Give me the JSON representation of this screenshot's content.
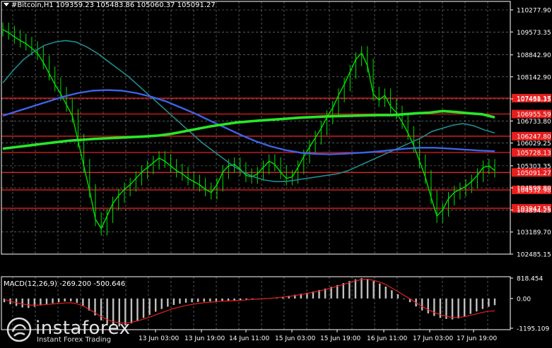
{
  "title": "#Bitcoin,H1  109359.23 105483.86 105060.37 105091.27",
  "macd_label": "MACD(12,26,9) -269.200 -500.646",
  "logo": {
    "brand": "instaforex",
    "tagline": "Instant Forex Trading"
  },
  "colors": {
    "background": "#000000",
    "candle": "#00e000",
    "ma_fast": "#208c8c",
    "ma_mid": "#3c64e6",
    "ma_slow": "#28e628",
    "level": "#e61e1e",
    "macd_hist": "#c0c0c0",
    "macd_signal": "#e61e1e",
    "axis_text": "#ffffff",
    "grid": "#ffffff"
  },
  "price_axis": {
    "ticks": [
      "110277.90",
      "109573.35",
      "108842.90",
      "108142.90",
      "107438.35",
      "106733.80",
      "106029.25",
      "105303.35",
      "104598.80",
      "103894.25",
      "103189.70",
      "102485.15"
    ],
    "min": 102485.15,
    "max": 110277.9
  },
  "macd_axis": {
    "ticks": [
      "818.454",
      "0.00",
      "-1195.109"
    ],
    "min": -1195.109,
    "max": 818.454
  },
  "time_axis": {
    "labels": [
      "13 Jun 03:00",
      "13 Jun 19:00",
      "14 Jun 11:00",
      "15 Jun 03:00",
      "15 Jun 19:00",
      "16 Jun 11:00",
      "17 Jun 03:00",
      "17 Jun 19:00"
    ]
  },
  "levels": [
    {
      "label": "107461.17",
      "value": 107461.17
    },
    {
      "label": "106955.59",
      "value": 106955.59
    },
    {
      "label": "106247.80",
      "value": 106247.8
    },
    {
      "label": "105728.13",
      "value": 105728.13
    },
    {
      "label": "105091.27",
      "value": 105091.27
    },
    {
      "label": "104532.98",
      "value": 104532.98
    },
    {
      "label": "103947.55",
      "value": 103947.55
    }
  ],
  "chart_data": {
    "type": "line",
    "symbol": "#Bitcoin",
    "timeframe": "H1",
    "series": [
      {
        "values": [
          109650,
          109550,
          109420,
          109300,
          109200,
          109050,
          108900,
          108600,
          108250,
          107900,
          107600,
          107250,
          106900,
          106100,
          105300,
          104500,
          103600,
          103300,
          103700,
          104100,
          104350,
          104550,
          104700,
          104900,
          105100,
          105250,
          105400,
          105550,
          105450,
          105300,
          105150,
          105050,
          104900,
          104800,
          104700,
          104550,
          104450,
          104700,
          105100,
          105300,
          105350,
          105200,
          105000,
          104950,
          105050,
          105250,
          105450,
          105350,
          105100,
          104900,
          104950,
          105250,
          105600,
          105900,
          106200,
          106500,
          106850,
          107150,
          107550,
          107900,
          108300,
          108700,
          108900,
          108500,
          107600,
          107400,
          107550,
          107200,
          107000,
          106700,
          106350,
          105950,
          105450,
          104950,
          104300,
          103700,
          103900,
          104250,
          104450,
          104550,
          104650,
          104800,
          105000,
          105250,
          105300,
          105150
        ]
      },
      {
        "values": [
          107950,
          108350,
          108700,
          108950,
          109150,
          109250,
          109300,
          109250,
          109100,
          108900,
          108650,
          108400,
          108150,
          107850,
          107550,
          107250,
          106950,
          106650,
          106350,
          106050,
          105800,
          105550,
          105300,
          105100,
          104950,
          104850,
          104800,
          104800,
          104850,
          104900,
          104950,
          105000,
          105050,
          105150,
          105300,
          105450,
          105600,
          105750,
          105900,
          106050,
          106200,
          106400,
          106500,
          106600,
          106650,
          106580,
          106450,
          106350
        ]
      },
      {
        "values": [
          106900,
          107050,
          107200,
          107350,
          107500,
          107620,
          107700,
          107720,
          107700,
          107620,
          107500,
          107350,
          107150,
          106950,
          106720,
          106500,
          106280,
          106080,
          105920,
          105800,
          105720,
          105680,
          105670,
          105690,
          105720,
          105750,
          105800,
          105850,
          105880,
          105880,
          105850,
          105820,
          105790,
          105770
        ]
      },
      {
        "values": [
          105850,
          105900,
          105950,
          106000,
          106050,
          106100,
          106130,
          106160,
          106180,
          106200,
          106220,
          106240,
          106270,
          106320,
          106400,
          106480,
          106560,
          106620,
          106680,
          106720,
          106750,
          106780,
          106810,
          106840,
          106860,
          106880,
          106890,
          106900,
          106910,
          106920,
          106920,
          106950,
          106980,
          107000,
          107050,
          107020,
          106980,
          106950,
          106850
        ]
      },
      {
        "values": [
          -150,
          -230,
          -300,
          -360,
          -380,
          -330,
          -280,
          -230,
          -190,
          -150,
          -120,
          -110,
          -170,
          -300,
          -480,
          -680,
          -880,
          -1020,
          -1080,
          -1120,
          -1080,
          -1000,
          -900,
          -780,
          -660,
          -530,
          -420,
          -330,
          -260,
          -210,
          -170,
          -150,
          -140,
          -130,
          -120,
          -110,
          -100,
          -90,
          -80,
          -60,
          -40,
          -20,
          -10,
          0,
          20,
          40,
          70,
          110,
          150,
          190,
          230,
          280,
          340,
          400,
          470,
          540,
          620,
          700,
          770,
          815,
          790,
          700,
          600,
          480,
          330,
          170,
          0,
          -150,
          -320,
          -480,
          -600,
          -700,
          -780,
          -820,
          -840,
          -800,
          -720,
          -620,
          -520,
          -420,
          -330,
          -269
        ]
      },
      {
        "values": [
          -40,
          -100,
          -170,
          -220,
          -260,
          -270,
          -260,
          -240,
          -220,
          -200,
          -180,
          -170,
          -210,
          -300,
          -430,
          -580,
          -730,
          -850,
          -930,
          -980,
          -990,
          -960,
          -900,
          -830,
          -750,
          -660,
          -570,
          -480,
          -400,
          -340,
          -280,
          -240,
          -200,
          -170,
          -150,
          -130,
          -110,
          -100,
          -90,
          -75,
          -55,
          -35,
          -20,
          -5,
          10,
          30,
          55,
          85,
          120,
          160,
          200,
          250,
          300,
          360,
          420,
          490,
          560,
          640,
          710,
          760,
          770,
          730,
          660,
          560,
          420,
          280,
          130,
          -10,
          -170,
          -320,
          -450,
          -560,
          -650,
          -710,
          -760,
          -760,
          -730,
          -680,
          -620,
          -560,
          -510,
          -500
        ]
      }
    ]
  }
}
